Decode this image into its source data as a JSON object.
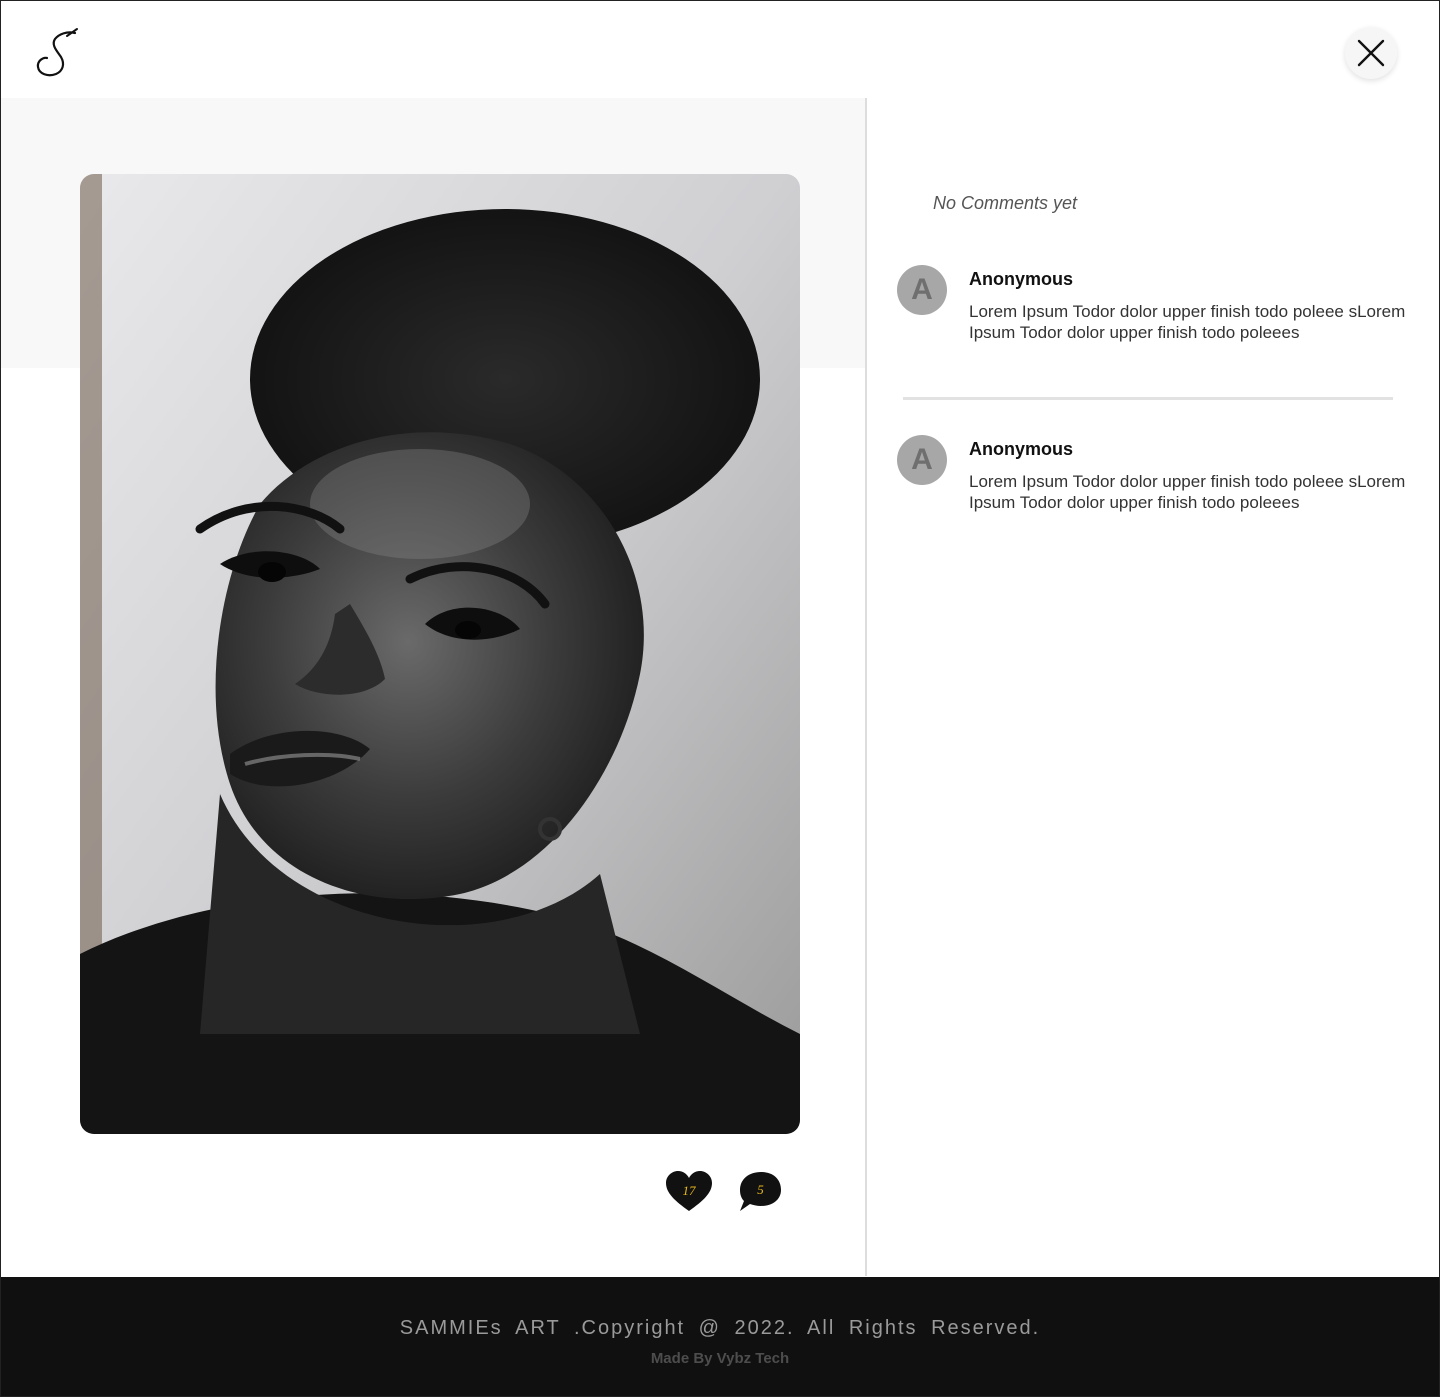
{
  "header": {
    "logo_icon": "signature-s-logo",
    "close_icon": "close-icon"
  },
  "post": {
    "artwork": "charcoal portrait artwork",
    "likes": {
      "icon": "heart-icon",
      "count": "17"
    },
    "comments": {
      "icon": "speech-bubble-icon",
      "count": "5"
    }
  },
  "comments_panel": {
    "empty_message": "No Comments yet",
    "items": [
      {
        "avatar_letter": "A",
        "author": "Anonymous",
        "text": "Lorem Ipsum Todor dolor upper finish todo poleee sLorem Ipsum Todor dolor upper finish todo poleees"
      },
      {
        "avatar_letter": "A",
        "author": "Anonymous",
        "text": "Lorem Ipsum Todor dolor upper finish todo poleee sLorem Ipsum Todor dolor upper finish todo poleees"
      }
    ]
  },
  "footer": {
    "copyright": "SAMMIEs ART .Copyright @ 2022. All Rights Reserved.",
    "made_by": "Made By Vybz Tech"
  },
  "colors": {
    "count_text": "#e8b81a",
    "footer_bg": "#101010",
    "avatar_bg": "#a7a7a7"
  }
}
